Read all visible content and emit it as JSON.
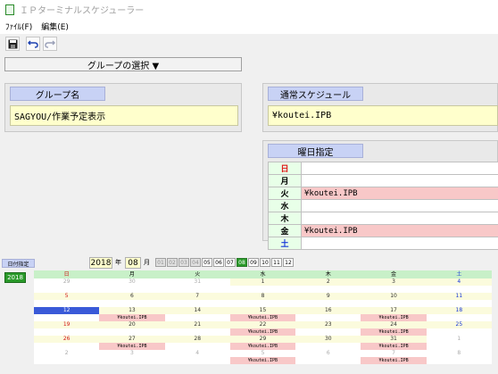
{
  "window": {
    "title": "ＩＰターミナルスケジューラー"
  },
  "menu": {
    "file": "ﾌｧｲﾙ(F)",
    "edit": "編集(E)"
  },
  "toolbar": {
    "save_icon": "save-icon",
    "undo_icon": "undo-icon",
    "redo_icon": "redo-icon"
  },
  "group_select": {
    "label": "グループの選択 ▼"
  },
  "group": {
    "header": "グループ名",
    "value": "SAGYOU/作業予定表示"
  },
  "schedule": {
    "header": "通常スケジュール",
    "value": "¥koutei.IPB"
  },
  "weekday": {
    "header": "曜日指定",
    "rows": [
      {
        "day": "日",
        "value": ""
      },
      {
        "day": "月",
        "value": ""
      },
      {
        "day": "火",
        "value": "¥koutei.IPB"
      },
      {
        "day": "水",
        "value": ""
      },
      {
        "day": "木",
        "value": ""
      },
      {
        "day": "金",
        "value": "¥koutei.IPB"
      },
      {
        "day": "土",
        "value": ""
      }
    ]
  },
  "calendar": {
    "tab_label": "日付指定",
    "year": "2018",
    "year_unit": "年",
    "month": "08",
    "month_unit": "月",
    "year_tag": "2018",
    "months": [
      "01",
      "02",
      "03",
      "04",
      "05",
      "06",
      "07",
      "08",
      "09",
      "10",
      "11",
      "12"
    ],
    "selected_month": "08",
    "day_headers": [
      "日",
      "月",
      "火",
      "水",
      "木",
      "金",
      "土"
    ],
    "weeks": [
      {
        "dates": [
          "29",
          "30",
          "31",
          "1",
          "2",
          "3",
          "4"
        ],
        "entries": [
          "",
          "",
          "",
          "",
          "",
          "",
          ""
        ]
      },
      {
        "dates": [
          "5",
          "6",
          "7",
          "8",
          "9",
          "10",
          "11"
        ],
        "entries": [
          "",
          "",
          "",
          "",
          "",
          "",
          ""
        ]
      },
      {
        "dates": [
          "12",
          "13",
          "14",
          "15",
          "16",
          "17",
          "18"
        ],
        "entries": [
          "",
          "¥koutei.IPB",
          "",
          "¥koutei.IPB",
          "",
          "¥koutei.IPB",
          ""
        ]
      },
      {
        "dates": [
          "19",
          "20",
          "21",
          "22",
          "23",
          "24",
          "25"
        ],
        "entries": [
          "",
          "",
          "",
          "¥koutei.IPB",
          "",
          "¥koutei.IPB",
          ""
        ]
      },
      {
        "dates": [
          "26",
          "27",
          "28",
          "29",
          "30",
          "31",
          "1"
        ],
        "entries": [
          "",
          "¥koutei.IPB",
          "",
          "¥koutei.IPB",
          "",
          "¥koutei.IPB",
          ""
        ]
      },
      {
        "dates": [
          "2",
          "3",
          "4",
          "5",
          "6",
          "7",
          "8"
        ],
        "entries": [
          "",
          "",
          "",
          "¥koutei.IPB",
          "",
          "¥koutei.IPB",
          ""
        ]
      }
    ],
    "colors": {
      "header_green": "#c8f0c8",
      "entry_pink": "#f8c8c8",
      "today_blue": "#3a5ad8",
      "selected_month_green": "#2a9a2a"
    }
  }
}
